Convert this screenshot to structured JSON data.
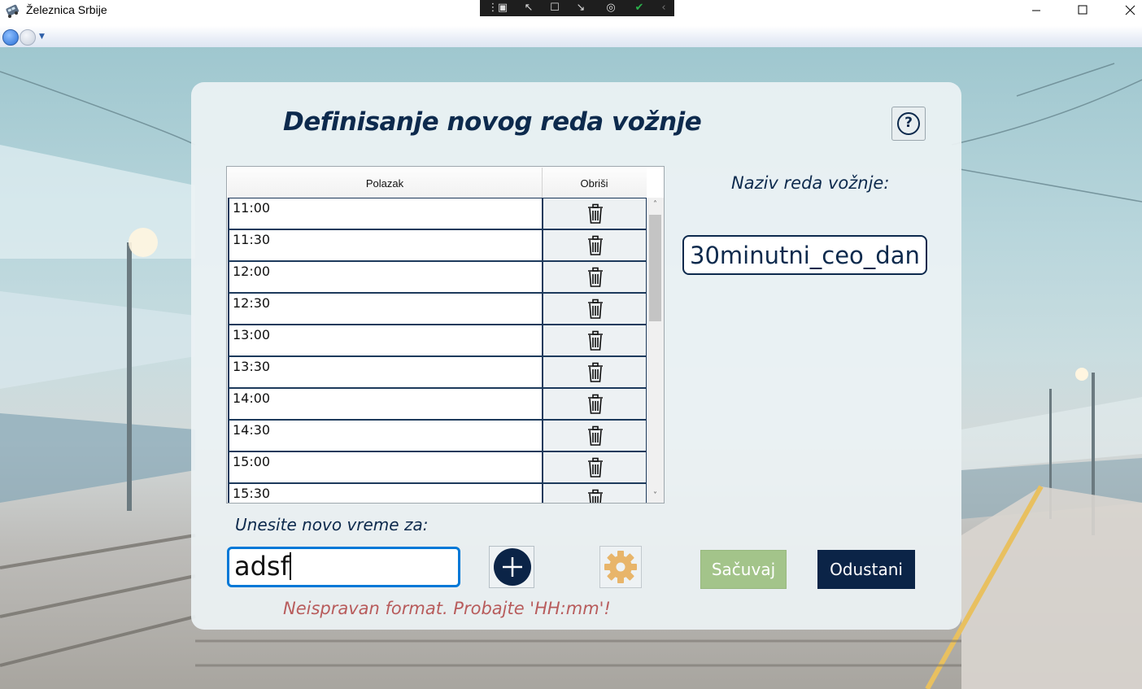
{
  "window": {
    "title": "Železnica Srbije"
  },
  "form": {
    "heading": "Definisanje novog reda vožnje",
    "help_label": "?",
    "columns": {
      "departure": "Polazak",
      "delete": "Obriši"
    },
    "rows": [
      {
        "time": "11:00"
      },
      {
        "time": "11:30"
      },
      {
        "time": "12:00"
      },
      {
        "time": "12:30"
      },
      {
        "time": "13:00"
      },
      {
        "time": "13:30"
      },
      {
        "time": "14:00"
      },
      {
        "time": "14:30"
      },
      {
        "time": "15:00"
      },
      {
        "time": "15:30"
      }
    ],
    "name_label": "Naziv reda vožnje:",
    "name_value": "30minutni_ceo_dan",
    "new_time_label": "Unesite novo vreme za:",
    "new_time_value": "adsf",
    "save_label": "Sačuvaj",
    "cancel_label": "Odustani",
    "error_message": "Neispravan format. Probajte 'HH:mm'!"
  },
  "colors": {
    "navy": "#0d2a4d",
    "save_green": "#a3c48a",
    "error_red": "#b85c5c",
    "focus_blue": "#0078d7",
    "gear_orange": "#e8b56a"
  }
}
